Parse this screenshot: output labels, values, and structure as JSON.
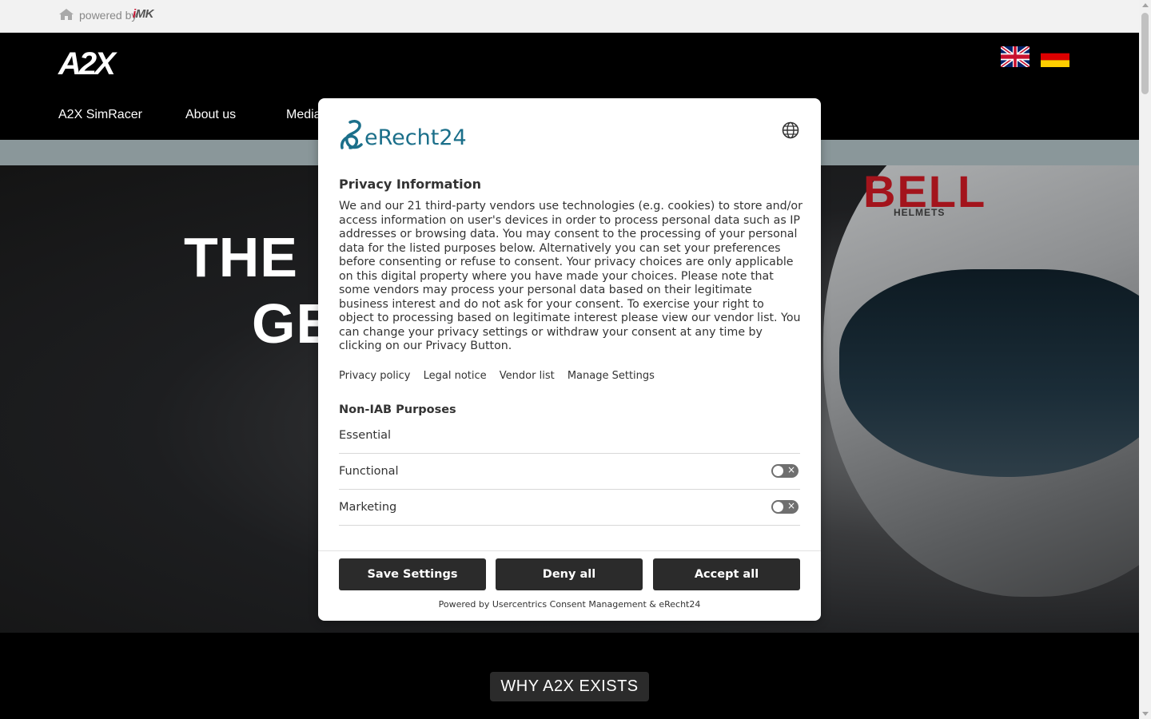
{
  "topbar": {
    "powered_label": "powered by",
    "brand": "iMK"
  },
  "header": {
    "logo": "A2X",
    "nav": [
      "A2X SimRacer",
      "About us",
      "Media"
    ],
    "languages": [
      "English",
      "Deutsch"
    ]
  },
  "hero": {
    "title_line1": "THE N",
    "title_line2": "GE",
    "helmet_brand": "BELL",
    "helmet_sub": "HELMETS"
  },
  "why": {
    "label": "WHY A2X EXISTS"
  },
  "consent": {
    "brand": "eRecht24",
    "title": "Privacy Information",
    "text": "We and our 21 third-party vendors use technologies (e.g. cookies) to store and/or access information on user's devices in order to process personal data such as IP addresses or browsing data. You may consent to the processing of your personal data for the listed purposes below. Alternatively you can set your preferences before consenting or refuse to consent. Your privacy choices are only applicable on this digital property where you have made your choices. Please note that some vendors may process your personal data based on their legitimate business interest and do not ask for your consent. To exercise your right to object to processing based on legitimate interest please view our vendor list. You can change your privacy settings or withdraw your consent at any time by clicking on our Privacy Button.",
    "links": [
      "Privacy policy",
      "Legal notice",
      "Vendor list",
      "Manage Settings"
    ],
    "section_title": "Non-IAB Purposes",
    "purposes": {
      "essential": "Essential",
      "functional": "Functional",
      "marketing": "Marketing"
    },
    "buttons": {
      "save": "Save Settings",
      "deny": "Deny all",
      "accept": "Accept all"
    },
    "powered_by": "Powered by Usercentrics Consent Management & eRecht24"
  }
}
